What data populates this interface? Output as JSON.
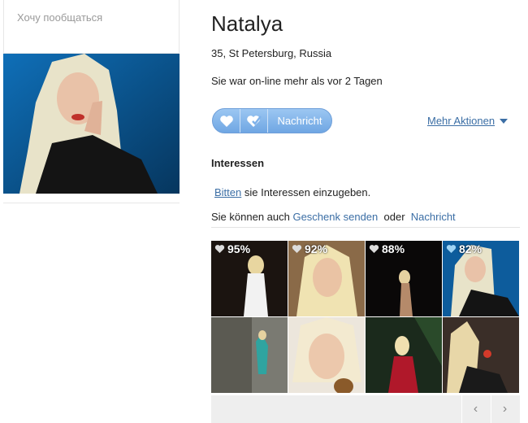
{
  "profile": {
    "status_text": "Хочу пообщаться",
    "name": "Natalya",
    "details": "35,  St Petersburg, Russia",
    "online_text": "Sie war on-line mehr als vor 2 Tagen"
  },
  "actions": {
    "like_icon": "heart-icon",
    "wink_icon": "heart-check-icon",
    "message_label": "Nachricht",
    "more_label": "Mehr Aktionen"
  },
  "interests": {
    "heading": "Interessen",
    "prompt_link": "Bitten",
    "prompt_rest": " sie Interessen einzugeben."
  },
  "gift": {
    "prefix": "Sie können auch ",
    "gift_link": "Geschenk senden",
    "or": "oder",
    "message_link": "Nachricht"
  },
  "photos": [
    {
      "rating": "95%",
      "heart_color": "#dddddd"
    },
    {
      "rating": "92%",
      "heart_color": "#dddddd"
    },
    {
      "rating": "88%",
      "heart_color": "#dddddd"
    },
    {
      "rating": "82%",
      "heart_color": "#9fd4f5"
    },
    {
      "rating": ""
    },
    {
      "rating": ""
    },
    {
      "rating": ""
    },
    {
      "rating": ""
    }
  ],
  "pager": {
    "prev": "‹",
    "next": "›"
  },
  "colors": {
    "link": "#3b6ea5",
    "button": "#7fb2ea"
  }
}
